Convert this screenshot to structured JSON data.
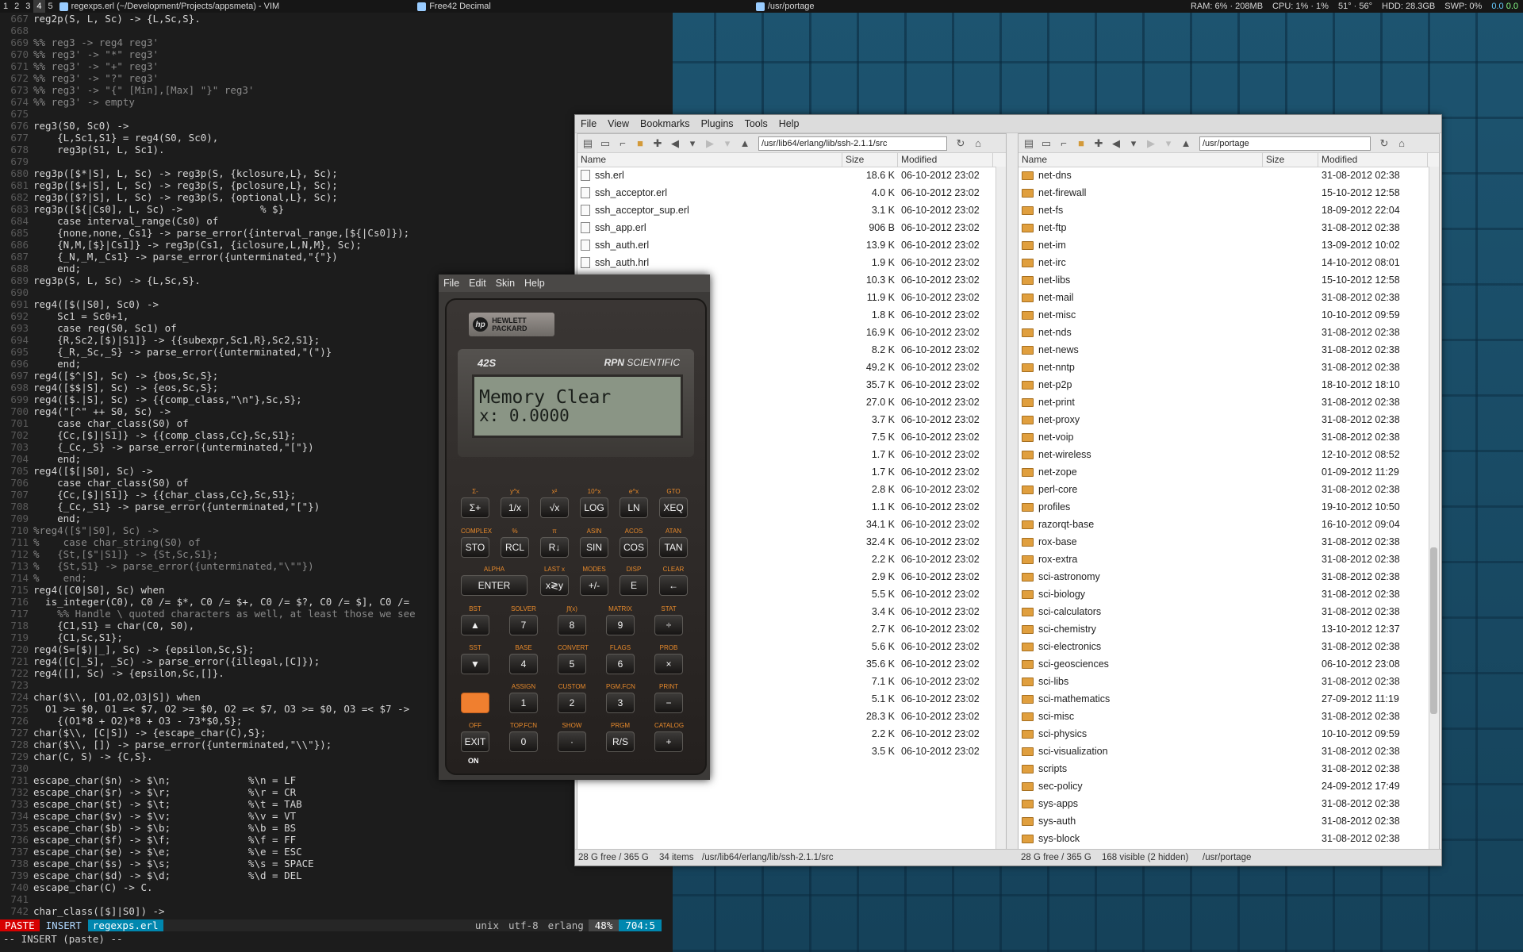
{
  "panel": {
    "workspaces": [
      "1",
      "2",
      "3",
      "4",
      "5"
    ],
    "active_workspace": "4",
    "tasks": [
      "regexps.erl (~/Development/Projects/appsmeta) - VIM",
      "Free42 Decimal",
      "/usr/portage"
    ],
    "stats": [
      "RAM: 6% · 208MB",
      "CPU: 1% · 1%",
      "51° · 56°",
      "HDD: 28.3GB",
      "SWP: 0%"
    ],
    "net_up": "0.0",
    "net_down": "0.0"
  },
  "vim": {
    "lines": [
      {
        "n": "667",
        "t": "reg2p(S, L, Sc) -> {L,Sc,S}.",
        "c": false
      },
      {
        "n": "668",
        "t": "",
        "c": false
      },
      {
        "n": "669",
        "t": "%% reg3 -> reg4 reg3'",
        "c": true
      },
      {
        "n": "670",
        "t": "%% reg3' -> \"*\" reg3'",
        "c": true
      },
      {
        "n": "671",
        "t": "%% reg3' -> \"+\" reg3'",
        "c": true
      },
      {
        "n": "672",
        "t": "%% reg3' -> \"?\" reg3'",
        "c": true
      },
      {
        "n": "673",
        "t": "%% reg3' -> \"{\" [Min],[Max] \"}\" reg3'",
        "c": true
      },
      {
        "n": "674",
        "t": "%% reg3' -> empty",
        "c": true
      },
      {
        "n": "675",
        "t": "",
        "c": false
      },
      {
        "n": "676",
        "t": "reg3(S0, Sc0) ->",
        "c": false
      },
      {
        "n": "677",
        "t": "    {L,Sc1,S1} = reg4(S0, Sc0),",
        "c": false
      },
      {
        "n": "678",
        "t": "    reg3p(S1, L, Sc1).",
        "c": false
      },
      {
        "n": "679",
        "t": "",
        "c": false
      },
      {
        "n": "680",
        "t": "reg3p([$*|S], L, Sc) -> reg3p(S, {kclosure,L}, Sc);",
        "c": false
      },
      {
        "n": "681",
        "t": "reg3p([$+|S], L, Sc) -> reg3p(S, {pclosure,L}, Sc);",
        "c": false
      },
      {
        "n": "682",
        "t": "reg3p([$?|S], L, Sc) -> reg3p(S, {optional,L}, Sc);",
        "c": false
      },
      {
        "n": "683",
        "t": "reg3p([${|Cs0], L, Sc) ->             % $}",
        "c": false
      },
      {
        "n": "684",
        "t": "    case interval_range(Cs0) of",
        "c": false
      },
      {
        "n": "685",
        "t": "    {none,none,_Cs1} -> parse_error({interval_range,[${|Cs0]});",
        "c": false
      },
      {
        "n": "686",
        "t": "    {N,M,[$}|Cs1]} -> reg3p(Cs1, {iclosure,L,N,M}, Sc);",
        "c": false
      },
      {
        "n": "687",
        "t": "    {_N,_M,_Cs1} -> parse_error({unterminated,\"{\"})",
        "c": false
      },
      {
        "n": "688",
        "t": "    end;",
        "c": false
      },
      {
        "n": "689",
        "t": "reg3p(S, L, Sc) -> {L,Sc,S}.",
        "c": false
      },
      {
        "n": "690",
        "t": "",
        "c": false
      },
      {
        "n": "691",
        "t": "reg4([$(|S0], Sc0) ->",
        "c": false
      },
      {
        "n": "692",
        "t": "    Sc1 = Sc0+1,",
        "c": false
      },
      {
        "n": "693",
        "t": "    case reg(S0, Sc1) of",
        "c": false
      },
      {
        "n": "694",
        "t": "    {R,Sc2,[$)|S1]} -> {{subexpr,Sc1,R},Sc2,S1};",
        "c": false
      },
      {
        "n": "695",
        "t": "    {_R,_Sc,_S} -> parse_error({unterminated,\"(\")}",
        "c": false
      },
      {
        "n": "696",
        "t": "    end;",
        "c": false
      },
      {
        "n": "697",
        "t": "reg4([$^|S], Sc) -> {bos,Sc,S};",
        "c": false
      },
      {
        "n": "698",
        "t": "reg4([$$|S], Sc) -> {eos,Sc,S};",
        "c": false
      },
      {
        "n": "699",
        "t": "reg4([$.|S], Sc) -> {{comp_class,\"\\n\"},Sc,S};",
        "c": false
      },
      {
        "n": "700",
        "t": "reg4(\"[^\" ++ S0, Sc) ->",
        "c": false
      },
      {
        "n": "701",
        "t": "    case char_class(S0) of",
        "c": false
      },
      {
        "n": "702",
        "t": "    {Cc,[$]|S1]} -> {{comp_class,Cc},Sc,S1};",
        "c": false
      },
      {
        "n": "703",
        "t": "    {_Cc,_S} -> parse_error({unterminated,\"[\"})",
        "c": false
      },
      {
        "n": "704",
        "t": "    end;",
        "c": false
      },
      {
        "n": "705",
        "t": "reg4([$[|S0], Sc) ->",
        "c": false
      },
      {
        "n": "706",
        "t": "    case char_class(S0) of",
        "c": false
      },
      {
        "n": "707",
        "t": "    {Cc,[$]|S1]} -> {{char_class,Cc},Sc,S1};",
        "c": false
      },
      {
        "n": "708",
        "t": "    {_Cc,_S1} -> parse_error({unterminated,\"[\"})",
        "c": false
      },
      {
        "n": "709",
        "t": "    end;",
        "c": false
      },
      {
        "n": "710",
        "t": "%reg4([$\"|S0], Sc) ->",
        "c": true
      },
      {
        "n": "711",
        "t": "%    case char_string(S0) of",
        "c": true
      },
      {
        "n": "712",
        "t": "%   {St,[$\"|S1]} -> {St,Sc,S1};",
        "c": true
      },
      {
        "n": "713",
        "t": "%   {St,S1} -> parse_error({unterminated,\"\\\"\"})",
        "c": true
      },
      {
        "n": "714",
        "t": "%    end;",
        "c": true
      },
      {
        "n": "715",
        "t": "reg4([C0|S0], Sc) when",
        "c": false
      },
      {
        "n": "716",
        "t": "  is_integer(C0), C0 /= $*, C0 /= $+, C0 /= $?, C0 /= $], C0 /=",
        "c": false
      },
      {
        "n": "717",
        "t": "    %% Handle \\ quoted characters as well, at least those we see",
        "c": true
      },
      {
        "n": "718",
        "t": "    {C1,S1} = char(C0, S0),",
        "c": false
      },
      {
        "n": "719",
        "t": "    {C1,Sc,S1};",
        "c": false
      },
      {
        "n": "720",
        "t": "reg4(S=[$)|_], Sc) -> {epsilon,Sc,S};",
        "c": false
      },
      {
        "n": "721",
        "t": "reg4([C|_S], _Sc) -> parse_error({illegal,[C]});",
        "c": false
      },
      {
        "n": "722",
        "t": "reg4([], Sc) -> {epsilon,Sc,[]}.",
        "c": false
      },
      {
        "n": "723",
        "t": "",
        "c": false
      },
      {
        "n": "724",
        "t": "char($\\\\, [O1,O2,O3|S]) when",
        "c": false
      },
      {
        "n": "725",
        "t": "  O1 >= $0, O1 =< $7, O2 >= $0, O2 =< $7, O3 >= $0, O3 =< $7 ->",
        "c": false
      },
      {
        "n": "726",
        "t": "    {(O1*8 + O2)*8 + O3 - 73*$0,S};",
        "c": false
      },
      {
        "n": "727",
        "t": "char($\\\\, [C|S]) -> {escape_char(C),S};",
        "c": false
      },
      {
        "n": "728",
        "t": "char($\\\\, []) -> parse_error({unterminated,\"\\\\\"});",
        "c": false
      },
      {
        "n": "729",
        "t": "char(C, S) -> {C,S}.",
        "c": false
      },
      {
        "n": "730",
        "t": "",
        "c": false
      },
      {
        "n": "731",
        "t": "escape_char($n) -> $\\n;             %\\n = LF",
        "c": false
      },
      {
        "n": "732",
        "t": "escape_char($r) -> $\\r;             %\\r = CR",
        "c": false
      },
      {
        "n": "733",
        "t": "escape_char($t) -> $\\t;             %\\t = TAB",
        "c": false
      },
      {
        "n": "734",
        "t": "escape_char($v) -> $\\v;             %\\v = VT",
        "c": false
      },
      {
        "n": "735",
        "t": "escape_char($b) -> $\\b;             %\\b = BS",
        "c": false
      },
      {
        "n": "736",
        "t": "escape_char($f) -> $\\f;             %\\f = FF",
        "c": false
      },
      {
        "n": "737",
        "t": "escape_char($e) -> $\\e;             %\\e = ESC",
        "c": false
      },
      {
        "n": "738",
        "t": "escape_char($s) -> $\\s;             %\\s = SPACE",
        "c": false
      },
      {
        "n": "739",
        "t": "escape_char($d) -> $\\d;             %\\d = DEL",
        "c": false
      },
      {
        "n": "740",
        "t": "escape_char(C) -> C.",
        "c": false
      },
      {
        "n": "741",
        "t": "",
        "c": false
      },
      {
        "n": "742",
        "t": "char_class([$]|S0]) ->",
        "c": false
      }
    ],
    "status": {
      "paste": "PASTE",
      "mode": "INSERT",
      "file": "regexps.erl",
      "format": "unix",
      "encoding": "utf-8",
      "filetype": "erlang",
      "percent": "48%",
      "position": "704:5"
    },
    "cmdline": "-- INSERT (paste) --"
  },
  "filemanager": {
    "menu": [
      "File",
      "View",
      "Bookmarks",
      "Plugins",
      "Tools",
      "Help"
    ],
    "columns": {
      "name": "Name",
      "size": "Size",
      "modified": "Modified"
    },
    "left": {
      "path": "/usr/lib64/erlang/lib/ssh-2.1.1/src",
      "rows": [
        {
          "name": "ssh.erl",
          "size": "18.6 K",
          "mod": "06-10-2012 23:02"
        },
        {
          "name": "ssh_acceptor.erl",
          "size": "4.0 K",
          "mod": "06-10-2012 23:02"
        },
        {
          "name": "ssh_acceptor_sup.erl",
          "size": "3.1 K",
          "mod": "06-10-2012 23:02"
        },
        {
          "name": "ssh_app.erl",
          "size": "906 B",
          "mod": "06-10-2012 23:02"
        },
        {
          "name": "ssh_auth.erl",
          "size": "13.9 K",
          "mod": "06-10-2012 23:02"
        },
        {
          "name": "ssh_auth.hrl",
          "size": "1.9 K",
          "mod": "06-10-2012 23:02"
        },
        {
          "name": "",
          "size": "10.3 K",
          "mod": "06-10-2012 23:02"
        },
        {
          "name": "",
          "size": "11.9 K",
          "mod": "06-10-2012 23:02"
        },
        {
          "name": "",
          "size": "1.8 K",
          "mod": "06-10-2012 23:02"
        },
        {
          "name": "",
          "size": "16.9 K",
          "mod": "06-10-2012 23:02"
        },
        {
          "name": "",
          "size": "8.2 K",
          "mod": "06-10-2012 23:02"
        },
        {
          "name": "",
          "size": "49.2 K",
          "mod": "06-10-2012 23:02"
        },
        {
          "name": "rl",
          "size": "35.7 K",
          "mod": "06-10-2012 23:02"
        },
        {
          "name": ".erl",
          "size": "27.0 K",
          "mod": "06-10-2012 23:02"
        },
        {
          "name": "",
          "size": "3.7 K",
          "mod": "06-10-2012 23:02"
        },
        {
          "name": "",
          "size": "7.5 K",
          "mod": "06-10-2012 23:02"
        },
        {
          "name": "",
          "size": "1.7 K",
          "mod": "06-10-2012 23:02"
        },
        {
          "name": "",
          "size": "1.7 K",
          "mod": "06-10-2012 23:02"
        },
        {
          "name": "",
          "size": "2.8 K",
          "mod": "06-10-2012 23:02"
        },
        {
          "name": "",
          "size": "1.1 K",
          "mod": "06-10-2012 23:02"
        },
        {
          "name": "",
          "size": "34.1 K",
          "mod": "06-10-2012 23:02"
        },
        {
          "name": "",
          "size": "32.4 K",
          "mod": "06-10-2012 23:02"
        },
        {
          "name": "",
          "size": "2.2 K",
          "mod": "06-10-2012 23:02"
        },
        {
          "name": "",
          "size": "2.9 K",
          "mod": "06-10-2012 23:02"
        },
        {
          "name": "",
          "size": "5.5 K",
          "mod": "06-10-2012 23:02"
        },
        {
          "name": "",
          "size": "3.4 K",
          "mod": "06-10-2012 23:02"
        },
        {
          "name": "",
          "size": "2.7 K",
          "mod": "06-10-2012 23:02"
        },
        {
          "name": "",
          "size": "5.6 K",
          "mod": "06-10-2012 23:02"
        },
        {
          "name": "",
          "size": "35.6 K",
          "mod": "06-10-2012 23:02"
        },
        {
          "name": "",
          "size": "7.1 K",
          "mod": "06-10-2012 23:02"
        },
        {
          "name": "",
          "size": "5.1 K",
          "mod": "06-10-2012 23:02"
        },
        {
          "name": "",
          "size": "28.3 K",
          "mod": "06-10-2012 23:02"
        },
        {
          "name": "",
          "size": "2.2 K",
          "mod": "06-10-2012 23:02"
        },
        {
          "name": "",
          "size": "3.5 K",
          "mod": "06-10-2012 23:02"
        }
      ],
      "status": {
        "free": "28 G free / 365 G",
        "count": "34 items",
        "path": "/usr/lib64/erlang/lib/ssh-2.1.1/src"
      }
    },
    "right": {
      "path": "/usr/portage",
      "rows": [
        {
          "name": "net-dns",
          "mod": "31-08-2012 02:38"
        },
        {
          "name": "net-firewall",
          "mod": "15-10-2012 12:58"
        },
        {
          "name": "net-fs",
          "mod": "18-09-2012 22:04"
        },
        {
          "name": "net-ftp",
          "mod": "31-08-2012 02:38"
        },
        {
          "name": "net-im",
          "mod": "13-09-2012 10:02"
        },
        {
          "name": "net-irc",
          "mod": "14-10-2012 08:01"
        },
        {
          "name": "net-libs",
          "mod": "15-10-2012 12:58"
        },
        {
          "name": "net-mail",
          "mod": "31-08-2012 02:38"
        },
        {
          "name": "net-misc",
          "mod": "10-10-2012 09:59"
        },
        {
          "name": "net-nds",
          "mod": "31-08-2012 02:38"
        },
        {
          "name": "net-news",
          "mod": "31-08-2012 02:38"
        },
        {
          "name": "net-nntp",
          "mod": "31-08-2012 02:38"
        },
        {
          "name": "net-p2p",
          "mod": "18-10-2012 18:10"
        },
        {
          "name": "net-print",
          "mod": "31-08-2012 02:38"
        },
        {
          "name": "net-proxy",
          "mod": "31-08-2012 02:38"
        },
        {
          "name": "net-voip",
          "mod": "31-08-2012 02:38"
        },
        {
          "name": "net-wireless",
          "mod": "12-10-2012 08:52"
        },
        {
          "name": "net-zope",
          "mod": "01-09-2012 11:29"
        },
        {
          "name": "perl-core",
          "mod": "31-08-2012 02:38"
        },
        {
          "name": "profiles",
          "mod": "19-10-2012 10:50"
        },
        {
          "name": "razorqt-base",
          "mod": "16-10-2012 09:04"
        },
        {
          "name": "rox-base",
          "mod": "31-08-2012 02:38"
        },
        {
          "name": "rox-extra",
          "mod": "31-08-2012 02:38"
        },
        {
          "name": "sci-astronomy",
          "mod": "31-08-2012 02:38"
        },
        {
          "name": "sci-biology",
          "mod": "31-08-2012 02:38"
        },
        {
          "name": "sci-calculators",
          "mod": "31-08-2012 02:38"
        },
        {
          "name": "sci-chemistry",
          "mod": "13-10-2012 12:37"
        },
        {
          "name": "sci-electronics",
          "mod": "31-08-2012 02:38"
        },
        {
          "name": "sci-geosciences",
          "mod": "06-10-2012 23:08"
        },
        {
          "name": "sci-libs",
          "mod": "31-08-2012 02:38"
        },
        {
          "name": "sci-mathematics",
          "mod": "27-09-2012 11:19"
        },
        {
          "name": "sci-misc",
          "mod": "31-08-2012 02:38"
        },
        {
          "name": "sci-physics",
          "mod": "10-10-2012 09:59"
        },
        {
          "name": "sci-visualization",
          "mod": "31-08-2012 02:38"
        },
        {
          "name": "scripts",
          "mod": "31-08-2012 02:38"
        },
        {
          "name": "sec-policy",
          "mod": "24-09-2012 17:49"
        },
        {
          "name": "sys-apps",
          "mod": "31-08-2012 02:38"
        },
        {
          "name": "sys-auth",
          "mod": "31-08-2012 02:38"
        },
        {
          "name": "sys-block",
          "mod": "31-08-2012 02:38"
        }
      ],
      "status": {
        "free": "28 G free / 365 G",
        "count": "168 visible (2 hidden)",
        "path": "/usr/portage"
      }
    }
  },
  "calculator": {
    "menu": [
      "File",
      "Edit",
      "Skin",
      "Help"
    ],
    "brand": "HEWLETT PACKARD",
    "brand_mark": "hp",
    "model": "42S",
    "rpn": "RPN",
    "scientific": "SCIENTIFIC",
    "display": {
      "line1": "Memory Clear",
      "line2": "x: 0.0000"
    },
    "rows": [
      [
        {
          "s": "Σ-",
          "k": "Σ+"
        },
        {
          "s": "y^x",
          "k": "1/x"
        },
        {
          "s": "x²",
          "k": "√x"
        },
        {
          "s": "10^x",
          "k": "LOG"
        },
        {
          "s": "e^x",
          "k": "LN"
        },
        {
          "s": "GTO",
          "k": "XEQ"
        }
      ],
      [
        {
          "s": "COMPLEX",
          "k": "STO"
        },
        {
          "s": "%",
          "k": "RCL"
        },
        {
          "s": "π",
          "k": "R↓"
        },
        {
          "s": "ASIN",
          "k": "SIN"
        },
        {
          "s": "ACOS",
          "k": "COS"
        },
        {
          "s": "ATAN",
          "k": "TAN"
        }
      ],
      [
        {
          "s": "ALPHA",
          "k": "ENTER"
        },
        {
          "s": "LAST x",
          "k": "x≷y"
        },
        {
          "s": "MODES",
          "k": "+/-"
        },
        {
          "s": "DISP",
          "k": "E"
        },
        {
          "s": "CLEAR",
          "k": "←"
        }
      ],
      [
        {
          "s": "BST",
          "k": "▲"
        },
        {
          "s": "SOLVER",
          "k": "7"
        },
        {
          "s": "∫f(x)",
          "k": "8"
        },
        {
          "s": "MATRIX",
          "k": "9"
        },
        {
          "s": "STAT",
          "k": "÷"
        }
      ],
      [
        {
          "s": "SST",
          "k": "▼"
        },
        {
          "s": "BASE",
          "k": "4"
        },
        {
          "s": "CONVERT",
          "k": "5"
        },
        {
          "s": "FLAGS",
          "k": "6"
        },
        {
          "s": "PROB",
          "k": "×"
        }
      ],
      [
        {
          "s": "",
          "k": ""
        },
        {
          "s": "ASSIGN",
          "k": "1"
        },
        {
          "s": "CUSTOM",
          "k": "2"
        },
        {
          "s": "PGM.FCN",
          "k": "3"
        },
        {
          "s": "PRINT",
          "k": "−"
        }
      ],
      [
        {
          "s": "OFF",
          "k": "EXIT"
        },
        {
          "s": "TOP.FCN",
          "k": "0"
        },
        {
          "s": "SHOW",
          "k": "·"
        },
        {
          "s": "PRGM",
          "k": "R/S"
        },
        {
          "s": "CATALOG",
          "k": "+"
        }
      ]
    ],
    "on_label": "ON"
  }
}
